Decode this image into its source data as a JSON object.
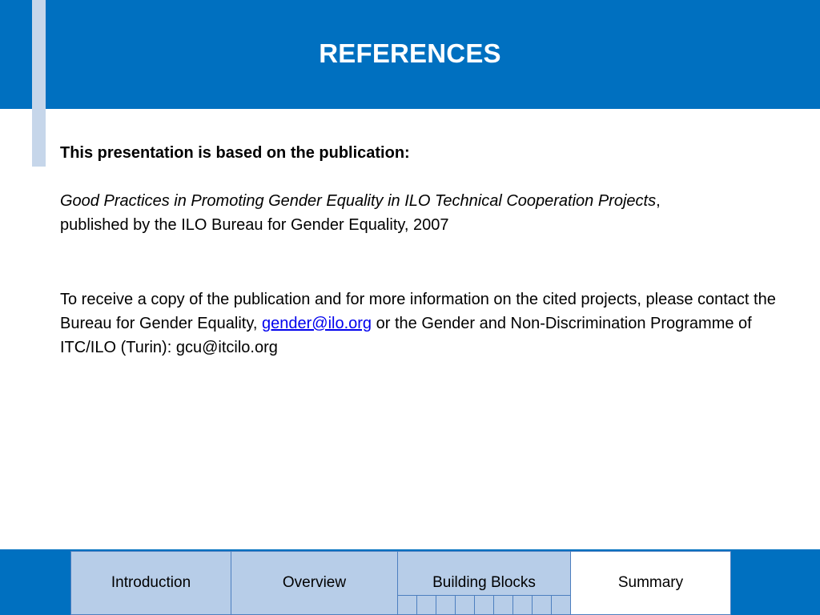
{
  "slide": {
    "title": "REFERENCES",
    "colors": {
      "header": "#0070c0",
      "accent_stripe": "#c6d6ea",
      "nav_tab": "#b7cde8",
      "active_tab": "#ffffff",
      "link": "#0000ee"
    }
  },
  "content": {
    "lead": "This presentation is based on the publication:",
    "publication_title": "Good Practices in Promoting Gender Equality in ILO Technical Cooperation Projects",
    "publication_comma": ",",
    "publication_details": "published by the ILO Bureau for Gender Equality, 2007",
    "contact_part1": "To receive a copy of the publication and for more information on the cited projects, please contact the Bureau for Gender Equality, ",
    "contact_email": "gender@ilo.org",
    "contact_part2": " or the Gender and Non-Discrimination Programme of ITC/ILO (Turin): gcu@itcilo.org"
  },
  "nav": {
    "tabs": [
      {
        "label": "Introduction"
      },
      {
        "label": "Overview"
      },
      {
        "label": "Building Blocks"
      },
      {
        "label": "Summary"
      }
    ],
    "active_tab": "Summary"
  }
}
